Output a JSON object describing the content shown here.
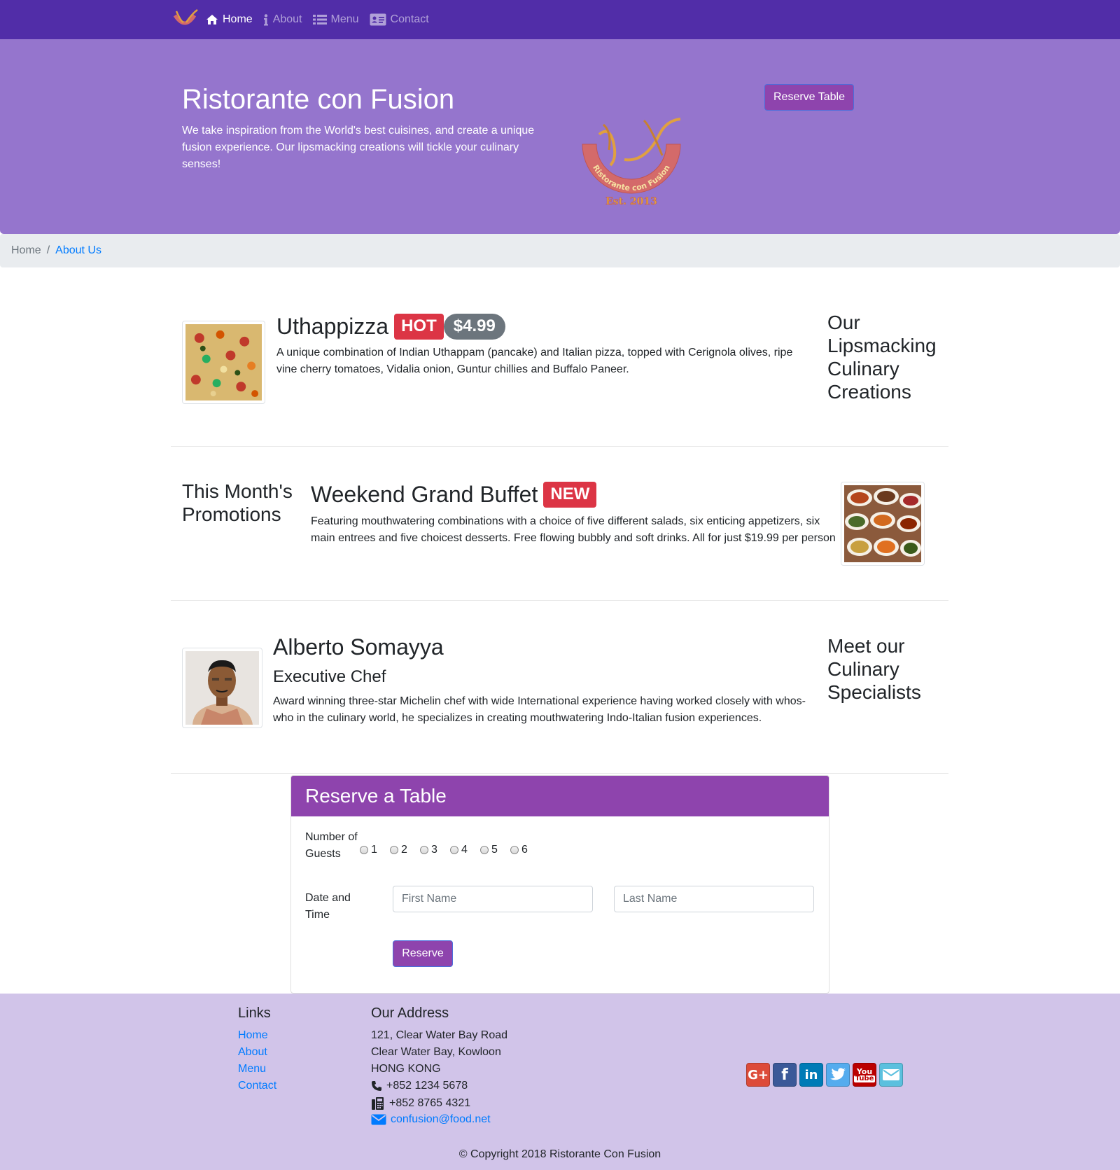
{
  "nav": {
    "items": [
      {
        "label": "Home",
        "active": true,
        "icon": "home-icon"
      },
      {
        "label": "About",
        "active": false,
        "icon": "info-icon"
      },
      {
        "label": "Menu",
        "active": false,
        "icon": "list-icon"
      },
      {
        "label": "Contact",
        "active": false,
        "icon": "address-card-icon"
      }
    ]
  },
  "jumbotron": {
    "title": "Ristorante con Fusion",
    "text": "We take inspiration from the World's best cuisines, and create a unique fusion experience. Our lipsmacking creations will tickle your culinary senses!",
    "logo_text": "Ristorante con Fusion",
    "logo_est": "Est. 2013",
    "reserve_button": "Reserve Table"
  },
  "breadcrumb": {
    "home": "Home",
    "separator": "/",
    "active": "About Us"
  },
  "dish": {
    "name": "Uthappizza",
    "badge": "HOT",
    "price": "$4.99",
    "description": "A unique combination of Indian Uthappam (pancake) and Italian pizza, topped with Cerignola olives, ripe vine cherry tomatoes, Vidalia onion, Guntur chillies and Buffalo Paneer.",
    "side_heading": "Our Lipsmacking Culinary Creations"
  },
  "promotion": {
    "side_heading": "This Month's Promotions",
    "name": "Weekend Grand Buffet",
    "badge": "NEW",
    "description": "Featuring mouthwatering combinations with a choice of five different salads, six enticing appetizers, six main entrees and five choicest desserts. Free flowing bubbly and soft drinks. All for just $19.99 per person"
  },
  "leader": {
    "name": "Alberto Somayya",
    "designation": "Executive Chef",
    "description": "Award winning three-star Michelin chef with wide International experience having worked closely with whos-who in the culinary world, he specializes in creating mouthwatering Indo-Italian fusion experiences.",
    "side_heading": "Meet our Culinary Specialists"
  },
  "reserve_form": {
    "title": "Reserve a Table",
    "guests_label": "Number of Guests",
    "guest_options": [
      "1",
      "2",
      "3",
      "4",
      "5",
      "6"
    ],
    "datetime_label": "Date and Time",
    "first_name_placeholder": "First Name",
    "last_name_placeholder": "Last Name",
    "submit_label": "Reserve"
  },
  "footer": {
    "links_heading": "Links",
    "links": [
      "Home",
      "About",
      "Menu",
      "Contact"
    ],
    "address_heading": "Our Address",
    "address_lines": [
      "121, Clear Water Bay Road",
      "Clear Water Bay, Kowloon",
      "HONG KONG"
    ],
    "phone": "+852 1234 5678",
    "fax": "+852 8765 4321",
    "email": "confusion@food.net",
    "social": [
      {
        "icon": "google-plus-icon",
        "color": "#dd4b39"
      },
      {
        "icon": "facebook-icon",
        "color": "#3b5998"
      },
      {
        "icon": "linkedin-icon",
        "color": "#007bb6"
      },
      {
        "icon": "twitter-icon",
        "color": "#55acee"
      },
      {
        "icon": "youtube-icon",
        "color": "#bb0000"
      },
      {
        "icon": "email-icon",
        "color": "#5bc0de"
      }
    ],
    "copyright": "© Copyright 2018 Ristorante Con Fusion"
  },
  "colors": {
    "navbar": "#512da8",
    "jumbotron": "#9575cd",
    "accent": "#8e44ad",
    "footer": "#d1c4e9"
  }
}
